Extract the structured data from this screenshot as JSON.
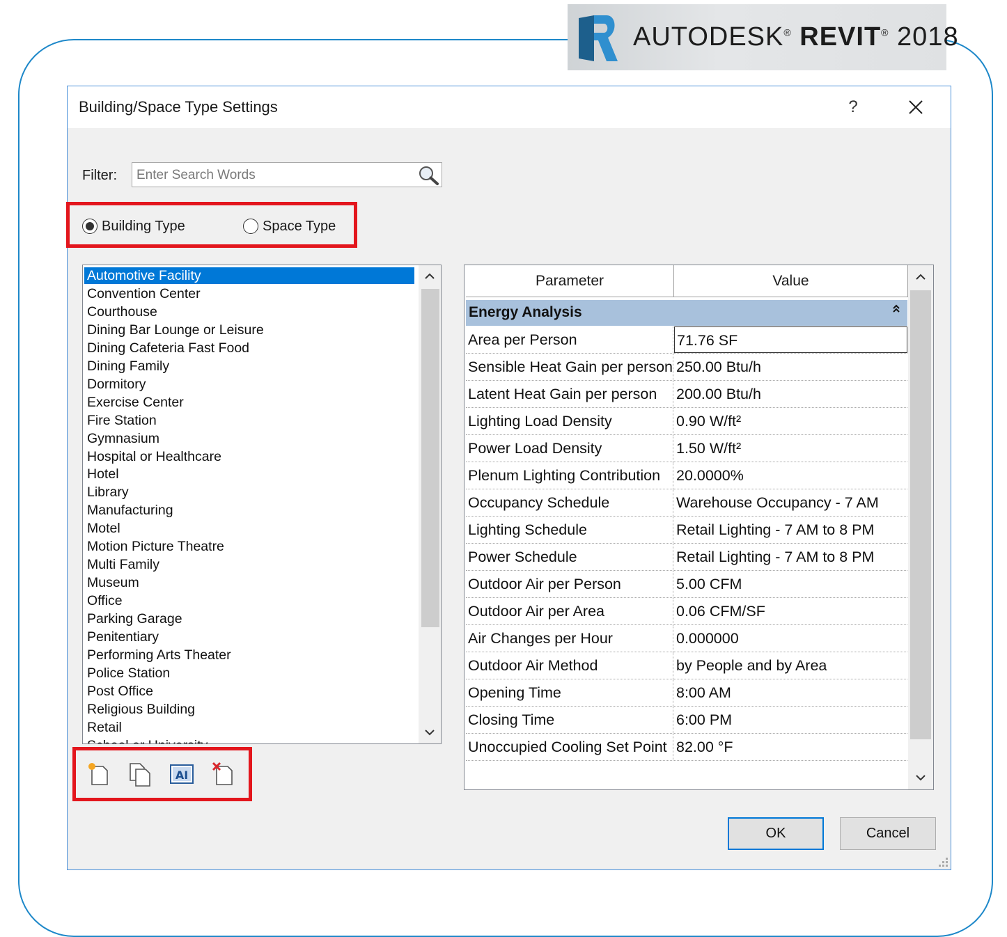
{
  "banner": {
    "brand_pre": "AUTODESK",
    "reg1": "®",
    "brand_bold": "REVIT",
    "reg2": "®",
    "version": "2018"
  },
  "dialog": {
    "title": "Building/Space Type Settings",
    "help_label": "?",
    "filter_label": "Filter:",
    "search_placeholder": "Enter Search Words",
    "radio_building": "Building Type",
    "radio_space": "Space Type",
    "selected_radio": "Building Type",
    "types": [
      "Automotive Facility",
      "Convention Center",
      "Courthouse",
      "Dining Bar Lounge or Leisure",
      "Dining Cafeteria Fast Food",
      "Dining Family",
      "Dormitory",
      "Exercise Center",
      "Fire Station",
      "Gymnasium",
      "Hospital or Healthcare",
      "Hotel",
      "Library",
      "Manufacturing",
      "Motel",
      "Motion Picture Theatre",
      "Multi Family",
      "Museum",
      "Office",
      "Parking Garage",
      "Penitentiary",
      "Performing Arts Theater",
      "Police Station",
      "Post Office",
      "Religious Building",
      "Retail",
      "School or University"
    ],
    "selected_type": "Automotive Facility",
    "table": {
      "col_parameter": "Parameter",
      "col_value": "Value",
      "group": "Energy Analysis",
      "rows": [
        {
          "param": "Area per Person",
          "value": "71.76 SF"
        },
        {
          "param": "Sensible Heat Gain per person",
          "value": "250.00 Btu/h"
        },
        {
          "param": "Latent Heat Gain per person",
          "value": "200.00 Btu/h"
        },
        {
          "param": "Lighting Load Density",
          "value": "0.90 W/ft²"
        },
        {
          "param": "Power Load Density",
          "value": "1.50 W/ft²"
        },
        {
          "param": "Plenum Lighting Contribution",
          "value": "20.0000%"
        },
        {
          "param": "Occupancy Schedule",
          "value": "Warehouse Occupancy - 7 AM"
        },
        {
          "param": "Lighting Schedule",
          "value": "Retail Lighting - 7 AM to 8 PM"
        },
        {
          "param": "Power Schedule",
          "value": "Retail Lighting - 7 AM to 8 PM"
        },
        {
          "param": "Outdoor Air per Person",
          "value": "5.00 CFM"
        },
        {
          "param": "Outdoor Air per Area",
          "value": "0.06 CFM/SF"
        },
        {
          "param": "Air Changes per Hour",
          "value": "0.000000"
        },
        {
          "param": "Outdoor Air Method",
          "value": "by People and by Area"
        },
        {
          "param": "Opening Time",
          "value": "8:00 AM"
        },
        {
          "param": "Closing Time",
          "value": "6:00 PM"
        },
        {
          "param": "Unoccupied Cooling Set Point",
          "value": "82.00 °F"
        }
      ]
    },
    "ok_label": "OK",
    "cancel_label": "Cancel",
    "tools": [
      "new-type-icon",
      "duplicate-icon",
      "rename-icon",
      "delete-icon"
    ]
  },
  "colors": {
    "accent": "#0078d7",
    "highlight_box": "#e3161d",
    "group_header": "#a8c1dc",
    "frame": "#1e88c9"
  }
}
